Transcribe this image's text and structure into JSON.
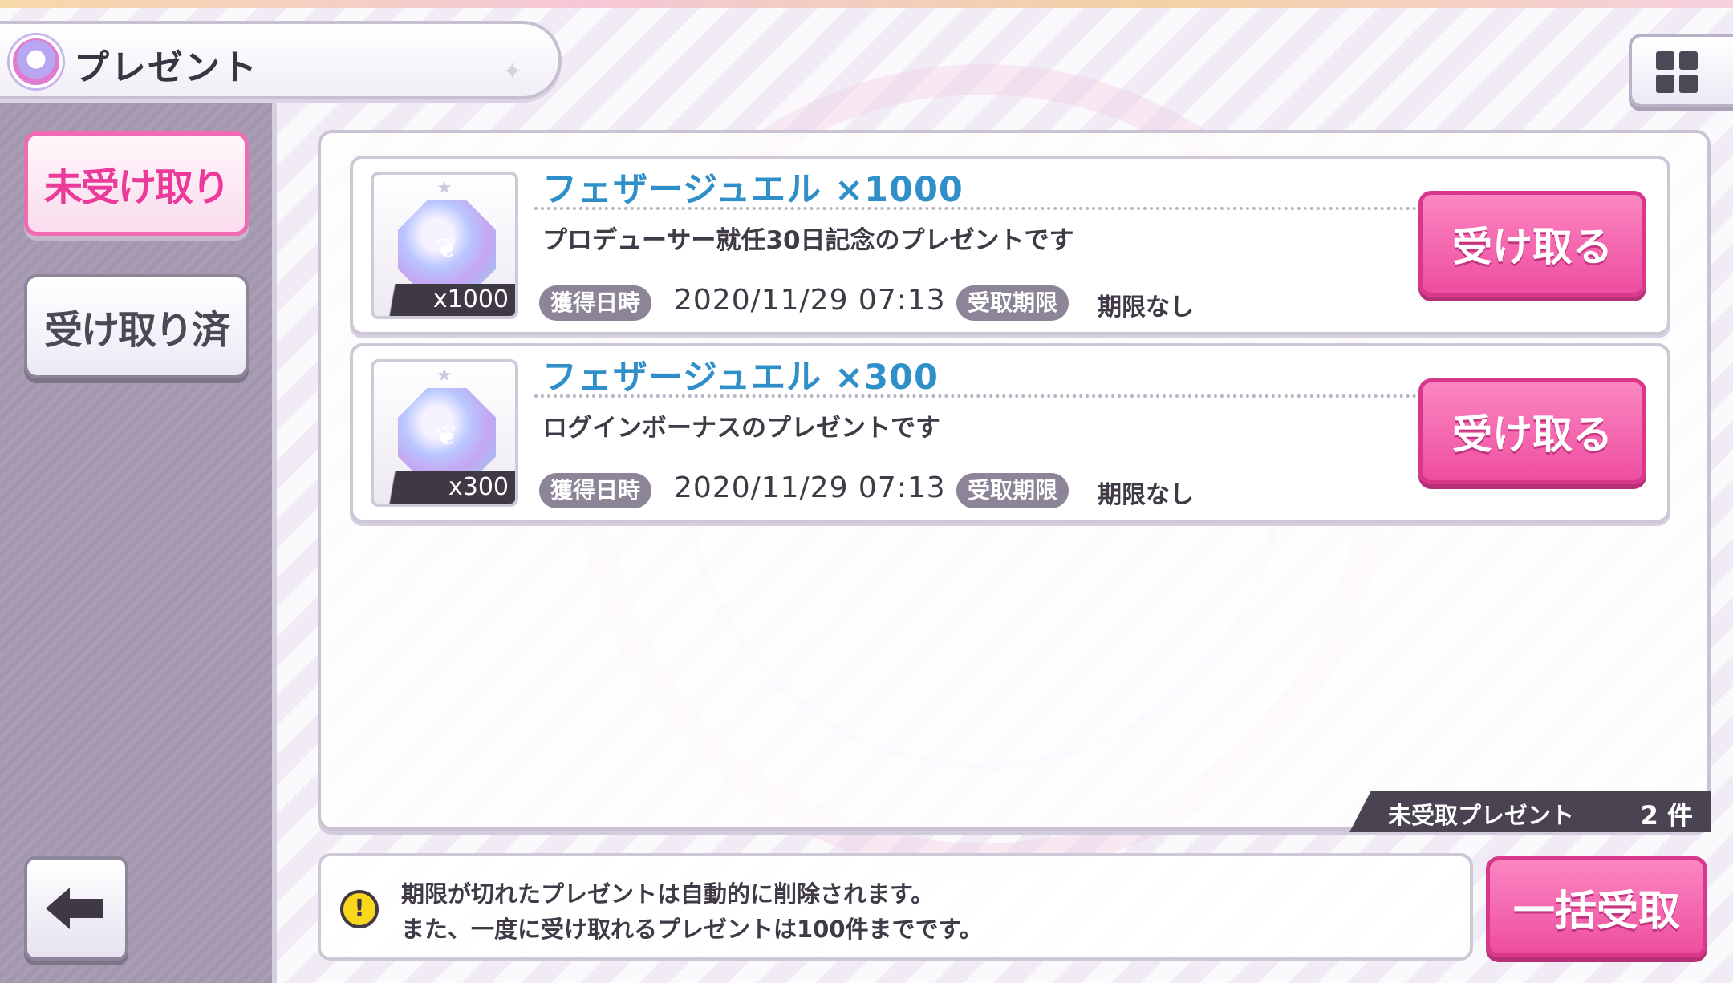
{
  "header": {
    "title": "プレゼント"
  },
  "sidebar": {
    "tabs": [
      {
        "label": "未受け取り",
        "active": true
      },
      {
        "label": "受け取り済",
        "active": false
      }
    ]
  },
  "items": [
    {
      "name": "フェザージュエル ×1000",
      "quantity_badge": "x1000",
      "description": "プロデューサー就任30日記念のプレゼントです",
      "date_tag": "獲得日時",
      "date": "2020/11/29 07:13",
      "limit_tag": "受取期限",
      "limit": "期限なし",
      "button": "受け取る",
      "icon": "feather-jewel-icon"
    },
    {
      "name": "フェザージュエル ×300",
      "quantity_badge": "x300",
      "description": "ログインボーナスのプレゼントです",
      "date_tag": "獲得日時",
      "date": "2020/11/29 07:13",
      "limit_tag": "受取期限",
      "limit": "期限なし",
      "button": "受け取る",
      "icon": "feather-jewel-icon"
    }
  ],
  "summary": {
    "label": "未受取プレゼント",
    "count": "2 件"
  },
  "notice": {
    "line1": "期限が切れたプレゼントは自動的に削除されます。",
    "line2": "また、一度に受け取れるプレゼントは100件までです。"
  },
  "bulk_button": "一括受取",
  "colors": {
    "accent_pink": "#ee4e9f",
    "item_name_blue": "#2f8fc9",
    "sidebar": "#a99db4"
  }
}
